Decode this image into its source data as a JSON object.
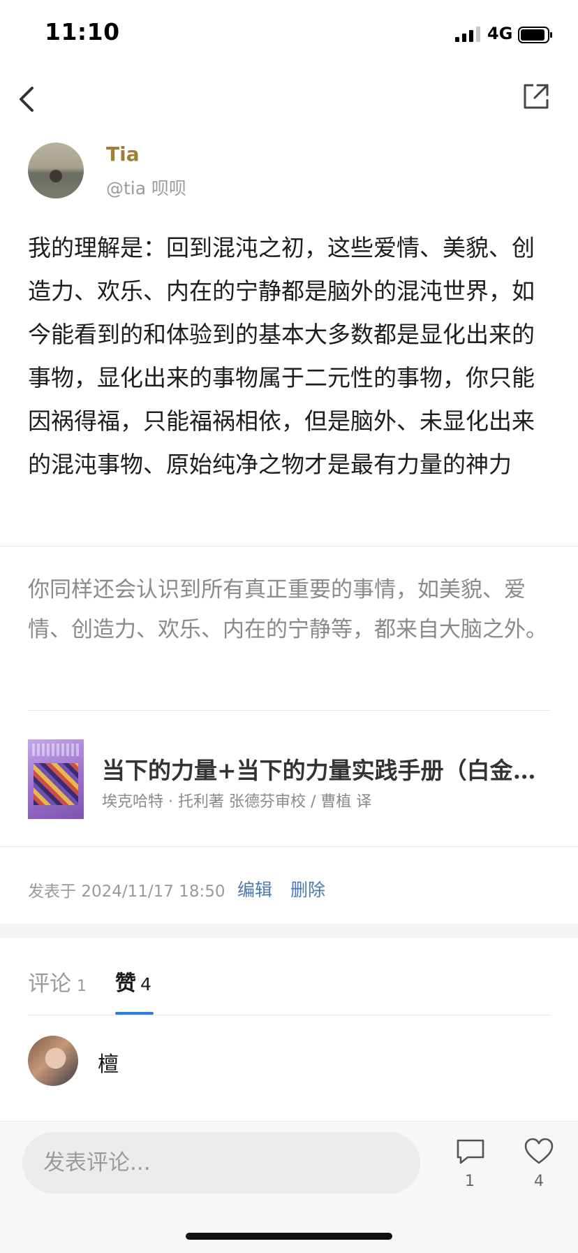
{
  "status_bar": {
    "time": "11:10",
    "network": "4G"
  },
  "author": {
    "name": "Tia",
    "handle": "@tia 呗呗"
  },
  "post": {
    "text": "我的理解是：回到混沌之初，这些爱情、美貌、创造力、欢乐、内在的宁静都是脑外的混沌世界，如今能看到的和体验到的基本大多数都是显化出来的事物，显化出来的事物属于二元性的事物，你只能因祸得福，只能福祸相依，但是脑外、未显化出来的混沌事物、原始纯净之物才是最有力量的神力",
    "quote": "你同样还会认识到所有真正重要的事情，如美貌、爱情、创造力、欢乐、内在的宁静等，都来自大脑之外。"
  },
  "book": {
    "title": "当下的力量+当下的力量实践手册（白金…",
    "meta": "埃克哈特 · 托利著 张德芬审校 / 曹植 译"
  },
  "publish": {
    "date_text": "发表于 2024/11/17 18:50",
    "edit_label": "编辑",
    "delete_label": "删除"
  },
  "tabs": {
    "comments_label": "评论",
    "comments_count": "1",
    "likes_label": "赞",
    "likes_count": "4"
  },
  "likers": [
    {
      "name": "檀"
    }
  ],
  "bottom_bar": {
    "input_placeholder": "发表评论...",
    "comment_count": "1",
    "like_count": "4"
  },
  "colors": {
    "accent_blue": "#2f7ed8",
    "link_blue": "#4a78b0",
    "author_gold": "#a07d3a"
  }
}
